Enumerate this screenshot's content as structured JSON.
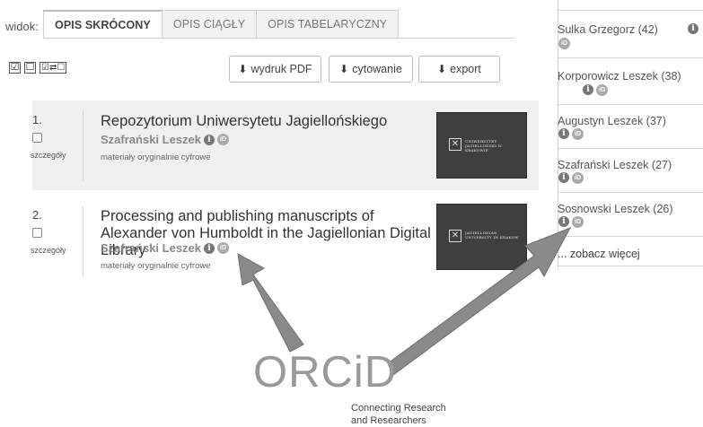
{
  "view": {
    "label": "widok:",
    "tabs": [
      {
        "label": "OPIS SKRÓCONY",
        "active": true
      },
      {
        "label": "OPIS CIĄGŁY",
        "active": false
      },
      {
        "label": "OPIS TABELARYCZNY",
        "active": false
      }
    ]
  },
  "toolbar": {
    "select_all_icon": "☑",
    "deselect_icon": "☐",
    "invert_icon": "☑⇄☐",
    "pdf_label": "wydruk PDF",
    "cite_label": "cytowanie",
    "export_label": "export",
    "download_icon": "download-icon"
  },
  "results": [
    {
      "number": "1.",
      "details_label": "szczegóły",
      "title": "Repozytorium Uniwersytetu Jagiellońskiego",
      "author": "Szafrański Leszek",
      "type": "materiały oryginalnie cyfrowe",
      "thumb_text": "UNIWERSYTET JAGIELLOŃSKI W KRAKOWIE"
    },
    {
      "number": "2.",
      "details_label": "szczegóły",
      "title": "Processing and publishing manuscripts of Alexander von Humboldt in the Jagiellonian Digital Library",
      "author": "Szafrański Leszek",
      "type": "materiały oryginalnie cyfrowe",
      "thumb_text": "JAGIELLONIAN UNIVERSITY IN KRAKOW"
    }
  ],
  "sidebar": {
    "authors": [
      {
        "text": "Sulka Grzegorz (42)"
      },
      {
        "text": "Korporowicz Leszek (38)"
      },
      {
        "text": "Augustyn Leszek (37)"
      },
      {
        "text": "Szafrański Leszek (27)"
      },
      {
        "text": "Sosnowski Leszek (26)"
      }
    ],
    "more": "... zobacz więcej"
  },
  "icons": {
    "info": "i",
    "orcid_id": "iD"
  },
  "orcid": {
    "logo": "ORCiD",
    "tagline_line1": "Connecting Research",
    "tagline_line2": "and Researchers"
  },
  "colors": {
    "tab_active_text": "#444444",
    "result_bg": "#f0f0f0",
    "thumb_bg": "#3f3f3f",
    "orcid_gray": "#999999",
    "arrow_gray": "#8a8a8a"
  }
}
